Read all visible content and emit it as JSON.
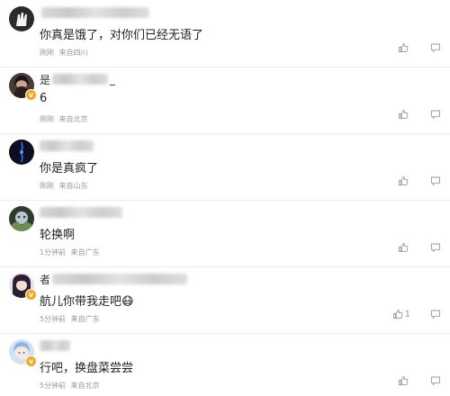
{
  "comments": [
    {
      "name_prefix": "",
      "name_suffix": "",
      "text": "你真是饿了，对你们已经无语了",
      "time": "刚刚",
      "location": "来自四川",
      "likes": "",
      "verified": false
    },
    {
      "name_prefix": "是",
      "name_suffix": "_",
      "text": "6",
      "time": "刚刚",
      "location": "来自北京",
      "likes": "",
      "verified": true
    },
    {
      "name_prefix": "",
      "name_suffix": "",
      "text": "你是真疯了",
      "time": "刚刚",
      "location": "来自山东",
      "likes": "",
      "verified": false
    },
    {
      "name_prefix": "",
      "name_suffix": "",
      "text": "轮换啊",
      "time": "1分钟前",
      "location": "来自广东",
      "likes": "",
      "verified": false
    },
    {
      "name_prefix": "者",
      "name_suffix": "",
      "text": "航儿你带我走吧😷",
      "time": "5分钟前",
      "location": "来自广东",
      "likes": "1",
      "verified": true
    },
    {
      "name_prefix": "",
      "name_suffix": "",
      "text": "行吧，换盘菜尝尝",
      "time": "5分钟前",
      "location": "来自北京",
      "likes": "",
      "verified": true
    }
  ],
  "icons": {
    "like": "thumbs-up-icon",
    "comment": "comment-icon"
  },
  "colors": {
    "meta_text": "#999999",
    "badge": "#f5a623",
    "divider": "#ececec"
  }
}
